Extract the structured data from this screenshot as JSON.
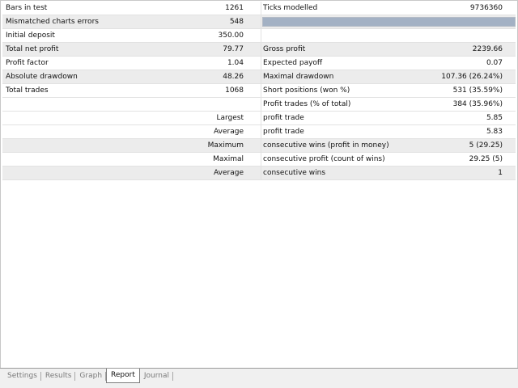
{
  "report": {
    "bars_in_test": {
      "label": "Bars in test",
      "value": "1261"
    },
    "ticks_modelled": {
      "label": "Ticks modelled",
      "value": "9736360"
    },
    "mismatched": {
      "label": "Mismatched charts errors",
      "value": "548"
    },
    "modelling_quality_progress": 1.0,
    "initial_deposit": {
      "label": "Initial deposit",
      "value": "350.00"
    },
    "total_net_profit": {
      "label": "Total net profit",
      "value": "79.77"
    },
    "gross_profit": {
      "label": "Gross profit",
      "value": "2239.66"
    },
    "profit_factor": {
      "label": "Profit factor",
      "value": "1.04"
    },
    "expected_payoff": {
      "label": "Expected payoff",
      "value": "0.07"
    },
    "absolute_drawdown": {
      "label": "Absolute drawdown",
      "value": "48.26"
    },
    "maximal_drawdown": {
      "label": "Maximal drawdown",
      "value": "107.36 (26.24%)"
    },
    "total_trades": {
      "label": "Total trades",
      "value": "1068"
    },
    "short_positions": {
      "label": "Short positions (won %)",
      "value": "531 (35.59%)"
    },
    "profit_trades": {
      "label": "Profit trades (% of total)",
      "value": "384 (35.96%)"
    },
    "largest_profit_trade": {
      "prefix": "Largest",
      "label": "profit trade",
      "value": "5.85"
    },
    "average_profit_trade": {
      "prefix": "Average",
      "label": "profit trade",
      "value": "5.83"
    },
    "max_consecutive_wins": {
      "prefix": "Maximum",
      "label": "consecutive wins (profit in money)",
      "value": "5 (29.25)"
    },
    "maximal_consecutive_profit": {
      "prefix": "Maximal",
      "label": "consecutive profit (count of wins)",
      "value": "29.25 (5)"
    },
    "average_consecutive_wins": {
      "prefix": "Average",
      "label": "consecutive wins",
      "value": "1"
    }
  },
  "tabs": [
    {
      "label": "Settings"
    },
    {
      "label": "Results"
    },
    {
      "label": "Graph"
    },
    {
      "label": "Report"
    },
    {
      "label": "Journal"
    }
  ],
  "active_tab": "Report"
}
